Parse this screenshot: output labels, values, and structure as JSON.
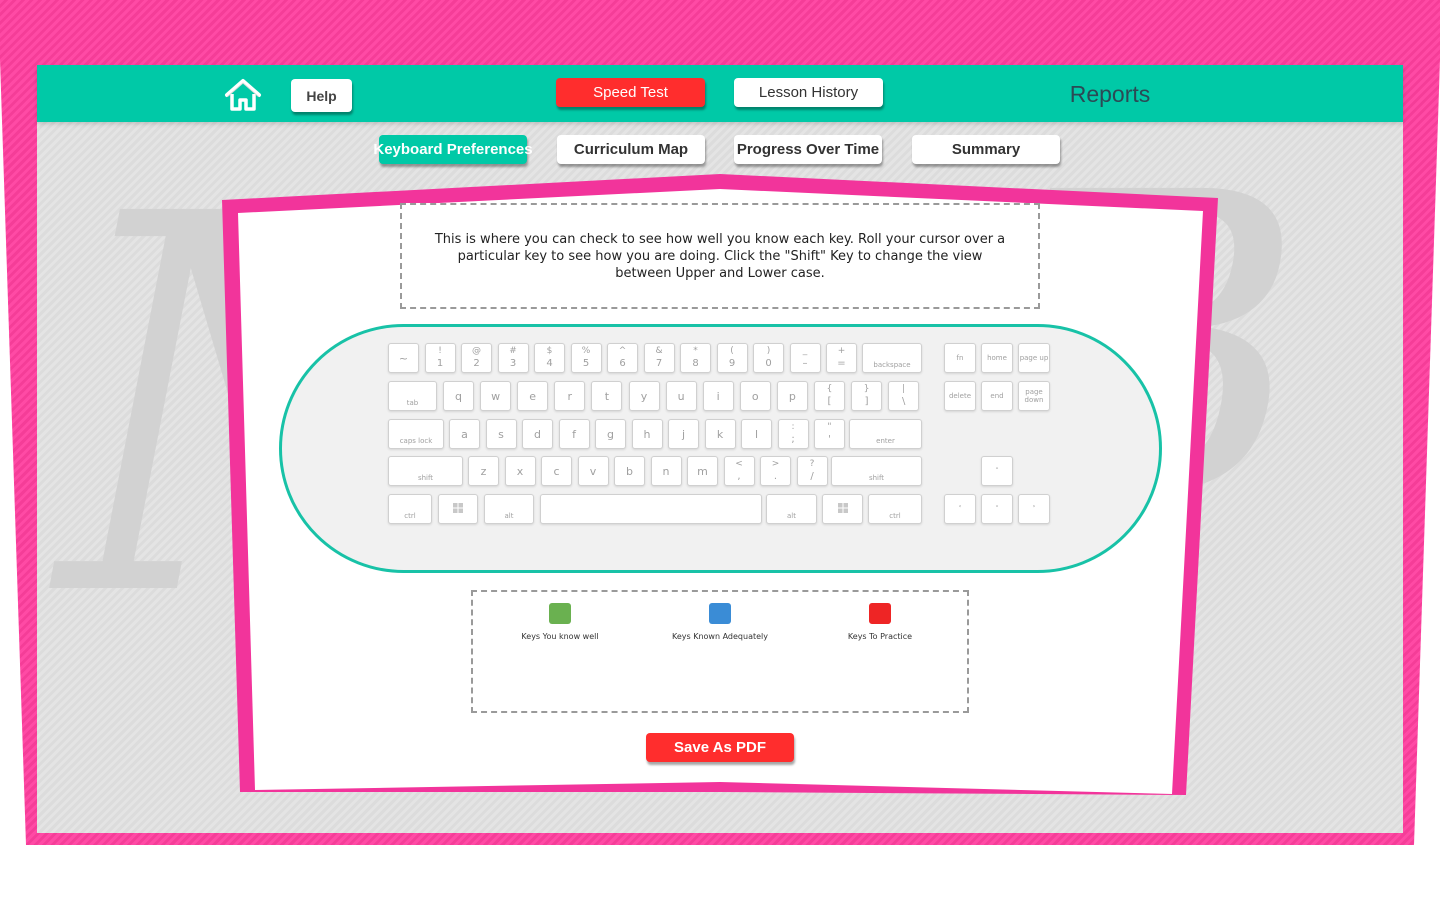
{
  "header": {
    "help_label": "Help",
    "speed_test_label": "Speed Test",
    "lesson_history_label": "Lesson History",
    "title": "Reports"
  },
  "subnav": {
    "keyboard_preferences": "Keyboard Preferences",
    "curriculum_map": "Curriculum Map",
    "progress_over_time": "Progress Over Time",
    "summary": "Summary"
  },
  "intro": {
    "text": "This is where you can check to see how well you know each key. Roll your cursor over a particular key to see how you are doing. Click the \"Shift\" Key to change the view between Upper and Lower case."
  },
  "keyboard": {
    "row1": [
      {
        "top": "",
        "bot": "~"
      },
      {
        "top": "!",
        "bot": "1"
      },
      {
        "top": "@",
        "bot": "2"
      },
      {
        "top": "#",
        "bot": "3"
      },
      {
        "top": "$",
        "bot": "4"
      },
      {
        "top": "%",
        "bot": "5"
      },
      {
        "top": "^",
        "bot": "6"
      },
      {
        "top": "&",
        "bot": "7"
      },
      {
        "top": "*",
        "bot": "8"
      },
      {
        "top": "(",
        "bot": "9"
      },
      {
        "top": ")",
        "bot": "0"
      },
      {
        "top": "_",
        "bot": "–"
      },
      {
        "top": "+",
        "bot": "="
      }
    ],
    "backspace": "backspace",
    "tab": "tab",
    "row2": [
      "q",
      "w",
      "e",
      "r",
      "t",
      "y",
      "u",
      "i",
      "o",
      "p"
    ],
    "row2_brackets": [
      {
        "top": "{",
        "bot": "["
      },
      {
        "top": "}",
        "bot": "]"
      },
      {
        "top": "|",
        "bot": "\\"
      }
    ],
    "caps_lock": "caps lock",
    "row3": [
      "a",
      "s",
      "d",
      "f",
      "g",
      "h",
      "j",
      "k",
      "l"
    ],
    "row3_punct": [
      {
        "top": ":",
        "bot": ";"
      },
      {
        "top": "\"",
        "bot": "'"
      }
    ],
    "enter": "enter",
    "shift_left": "shift",
    "row4": [
      "z",
      "x",
      "c",
      "v",
      "b",
      "n",
      "m"
    ],
    "row4_punct": [
      {
        "top": "<",
        "bot": ","
      },
      {
        "top": ">",
        "bot": "."
      },
      {
        "top": "?",
        "bot": "/"
      }
    ],
    "shift_right": "shift",
    "ctrl_left": "ctrl",
    "alt_left": "alt",
    "alt_right": "alt",
    "ctrl_right": "ctrl",
    "nav": {
      "fn": "fn",
      "home": "home",
      "page_up": "page up",
      "delete": "delete",
      "end": "end",
      "page_down": "page down",
      "up": "˄",
      "left": "˂",
      "down": "˅",
      "right": "˃"
    }
  },
  "legend": {
    "items": [
      {
        "label": "Keys You know well",
        "color": "#6ab150"
      },
      {
        "label": "Keys Known Adequately",
        "color": "#3a8cd6"
      },
      {
        "label": "Keys To Practice",
        "color": "#ee2525"
      }
    ]
  },
  "actions": {
    "save_pdf_label": "Save As PDF"
  },
  "colors": {
    "frame_pink": "#f2349b",
    "topbar_teal": "#00c9a7",
    "title_text": "#2b4a55",
    "red_button": "#ff2d2d"
  }
}
